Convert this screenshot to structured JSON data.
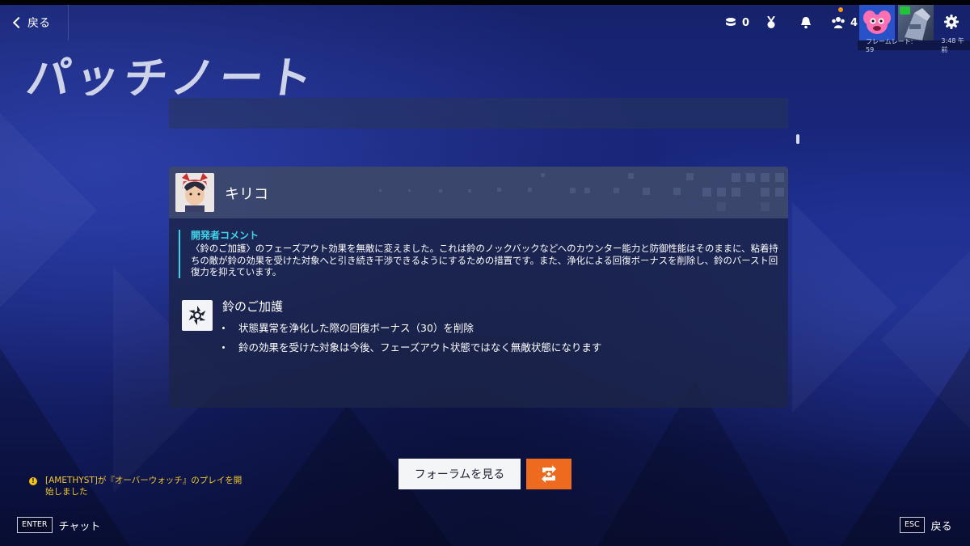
{
  "topbar": {
    "back_label": "戻る",
    "currency_count": "0",
    "group_count": "4",
    "fps_label": "フレームレート: 59",
    "time": "3:48 午前"
  },
  "page": {
    "title": "パッチノート"
  },
  "hero": {
    "name": "キリコ",
    "dev_comment_label": "開発者コメント",
    "dev_comment_text": "〈鈴のご加護〉のフェーズアウト効果を無敵に変えました。これは鈴のノックバックなどへのカウンター能力と防御性能はそのままに、粘着持ちの敵が鈴の効果を受けた対象へと引き続き干渉できるようにするための措置です。また、浄化による回復ボーナスを削除し、鈴のバースト回復力を抑えています。",
    "ability": {
      "name": "鈴のご加護",
      "changes": [
        "状態異常を浄化した際の回復ボーナス（30）を削除",
        "鈴の効果を受けた対象は今後、フェーズアウト状態ではなく無敵状態になります"
      ]
    }
  },
  "actions": {
    "forum_label": "フォーラムを見る"
  },
  "notification": {
    "text": "[AMETHYST]が『オーバーウォッチ』のプレイを開始しました"
  },
  "hints": {
    "enter_key": "ENTER",
    "enter_label": "チャット",
    "esc_key": "ESC",
    "esc_label": "戻る"
  },
  "colors": {
    "accent_cyan": "#35d4e8",
    "accent_orange": "#ee6a1e",
    "notify_yellow": "#f4c82a"
  }
}
